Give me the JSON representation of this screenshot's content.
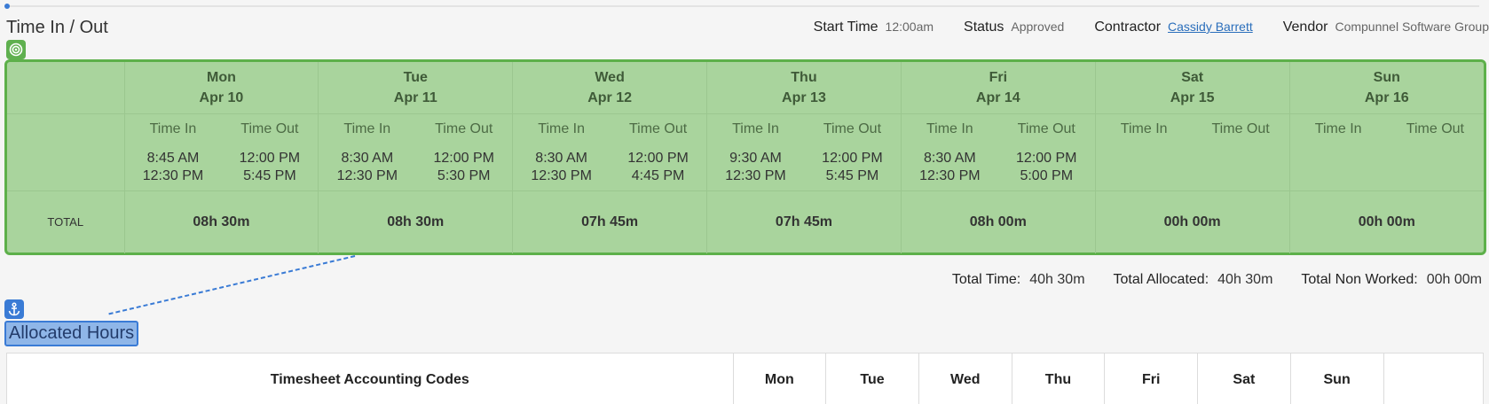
{
  "page": {
    "title": "Time In / Out"
  },
  "meta": [
    {
      "label": "Start Time",
      "value": "12:00am"
    },
    {
      "label": "Status",
      "value": "Approved"
    },
    {
      "label": "Contractor",
      "value": "Cassidy Barrett"
    },
    {
      "label": "Vendor",
      "value": "Compunnel Software Group"
    }
  ],
  "icons": {
    "target": "target-icon",
    "anchor": "anchor-icon"
  },
  "colors": {
    "grid_bg": "#a9d49d",
    "grid_border": "#5db04a",
    "link": "#2a6ebb",
    "highlight": "#8fb6e8"
  },
  "timesheet": {
    "time_in_label": "Time In",
    "time_out_label": "Time Out",
    "total_label": "TOTAL",
    "days": [
      {
        "name": "Mon",
        "date": "Apr 10",
        "in": [
          "8:45 AM",
          "12:30 PM"
        ],
        "out": [
          "12:00 PM",
          "5:45 PM"
        ],
        "total": "08h 30m"
      },
      {
        "name": "Tue",
        "date": "Apr 11",
        "in": [
          "8:30 AM",
          "12:30 PM"
        ],
        "out": [
          "12:00 PM",
          "5:30 PM"
        ],
        "total": "08h 30m"
      },
      {
        "name": "Wed",
        "date": "Apr 12",
        "in": [
          "8:30 AM",
          "12:30 PM"
        ],
        "out": [
          "12:00 PM",
          "4:45 PM"
        ],
        "total": "07h 45m"
      },
      {
        "name": "Thu",
        "date": "Apr 13",
        "in": [
          "9:30 AM",
          "12:30 PM"
        ],
        "out": [
          "12:00 PM",
          "5:45 PM"
        ],
        "total": "07h 45m"
      },
      {
        "name": "Fri",
        "date": "Apr 14",
        "in": [
          "8:30 AM",
          "12:30 PM"
        ],
        "out": [
          "12:00 PM",
          "5:00 PM"
        ],
        "total": "08h 00m"
      },
      {
        "name": "Sat",
        "date": "Apr 15",
        "in": [
          "",
          ""
        ],
        "out": [
          "",
          ""
        ],
        "total": "00h 00m"
      },
      {
        "name": "Sun",
        "date": "Apr 16",
        "in": [
          "",
          ""
        ],
        "out": [
          "",
          ""
        ],
        "total": "00h 00m"
      }
    ]
  },
  "summary": [
    {
      "label": "Total Time:",
      "value": "40h 30m"
    },
    {
      "label": "Total Allocated:",
      "value": "40h 30m"
    },
    {
      "label": "Total Non Worked:",
      "value": "00h 00m"
    }
  ],
  "allocated": {
    "title": "Allocated Hours",
    "codes_header": "Timesheet Accounting Codes",
    "days": [
      "Mon",
      "Tue",
      "Wed",
      "Thu",
      "Fri",
      "Sat",
      "Sun"
    ]
  }
}
